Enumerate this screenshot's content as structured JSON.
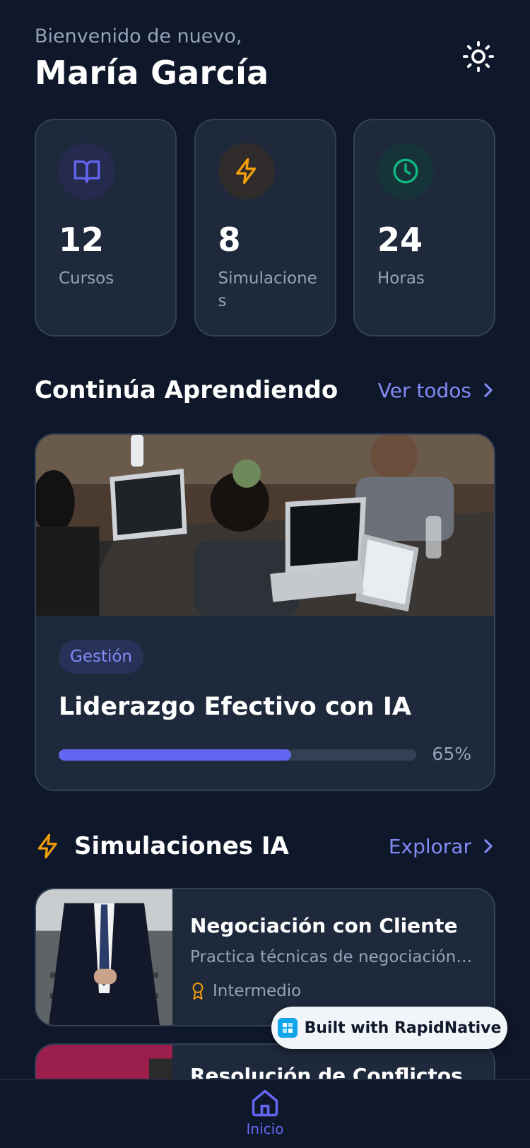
{
  "header": {
    "greeting": "Bienvenido de nuevo,",
    "user_name": "María García",
    "theme_icon": "sun-icon"
  },
  "stats": [
    {
      "value": "12",
      "label": "Cursos",
      "icon": "book-icon",
      "color": "#6366f1"
    },
    {
      "value": "8",
      "label": "Simulaciones",
      "icon": "lightning-icon",
      "color": "#f59e0b"
    },
    {
      "value": "24",
      "label": "Horas",
      "icon": "clock-icon",
      "color": "#10b981"
    }
  ],
  "continue_section": {
    "title": "Continúa Aprendiendo",
    "link": "Ver todos"
  },
  "course": {
    "tag": "Gestión",
    "title": "Liderazgo Efectivo con IA",
    "progress": 0.65,
    "progress_label": "65%"
  },
  "simulations_section": {
    "title": "Simulaciones IA",
    "link": "Explorar"
  },
  "simulations": [
    {
      "title": "Negociación con Cliente",
      "description": "Practica técnicas de negociación efectiva",
      "level": "Intermedio"
    },
    {
      "title": "Resolución de Conflictos"
    }
  ],
  "badge": {
    "label": "Built with RapidNative"
  },
  "nav": {
    "home_label": "Inicio"
  },
  "colors": {
    "background": "#0f172a",
    "card": "#1e293b",
    "accent": "#6366f1",
    "accent_text": "#818cf8",
    "warning": "#f59e0b",
    "success": "#10b981"
  }
}
